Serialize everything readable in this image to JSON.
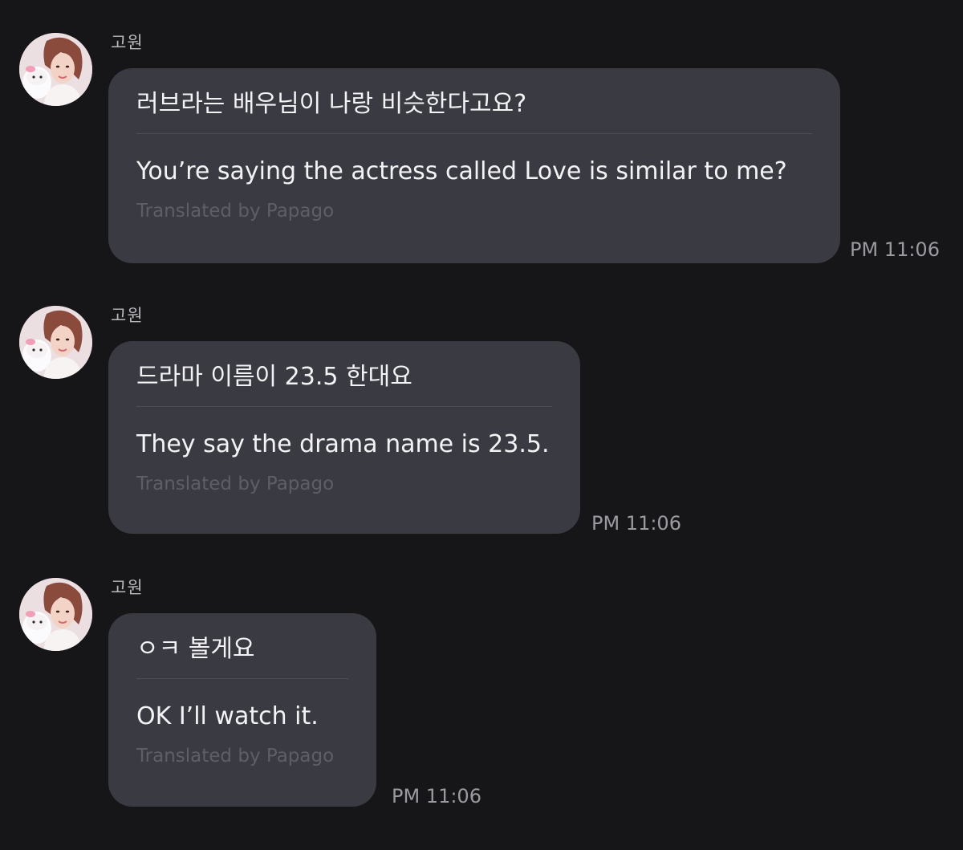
{
  "messages": [
    {
      "sender": "고원",
      "original": "러브라는 배우님이 나랑 비슷한다고요?",
      "translated": "You’re saying the actress called Love is similar to me?",
      "credit": "Translated by Papago",
      "time": "PM 11:06"
    },
    {
      "sender": "고원",
      "original": "드라마 이름이 23.5 한대요",
      "translated": "They say the drama name is 23.5.",
      "credit": "Translated by Papago",
      "time": "PM 11:06"
    },
    {
      "sender": "고원",
      "original": "ㅇㅋ 볼게요",
      "translated": "OK I’ll watch it.",
      "credit": "Translated by Papago",
      "time": "PM 11:06"
    }
  ],
  "colors": {
    "background": "#161619",
    "bubble": "#3a3a42",
    "text": "#f3f3f6",
    "sender": "#b9b9be",
    "credit": "#5e5e67",
    "timestamp": "#9a9aa0"
  }
}
